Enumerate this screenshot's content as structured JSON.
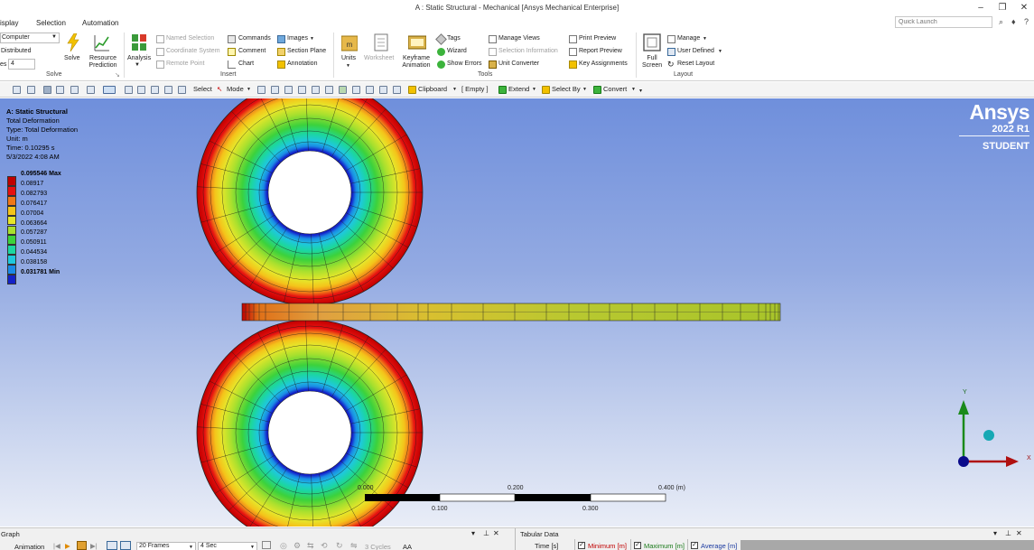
{
  "window": {
    "title": "A : Static Structural - Mechanical [Ansys Mechanical Enterprise]"
  },
  "menu": {
    "items": [
      "isplay",
      "Selection",
      "Automation"
    ],
    "quick_launch_placeholder": "Quick Launch"
  },
  "ribbon": {
    "solve": {
      "location_value": "Computer",
      "distributed_label": "Distributed",
      "cores_label": "es",
      "cores_value": "4",
      "solve_label": "Solve",
      "resource_prediction_label": "Resource Prediction",
      "group_label": "Solve"
    },
    "insert": {
      "analysis_label": "Analysis",
      "named_selection": "Named Selection",
      "coordinate_system": "Coordinate System",
      "remote_point": "Remote Point",
      "commands": "Commands",
      "comment": "Comment",
      "chart": "Chart",
      "images": "Images",
      "section_plane": "Section Plane",
      "annotation": "Annotation",
      "group_label": "Insert"
    },
    "tools": {
      "units": "Units",
      "worksheet": "Worksheet",
      "keyframe_animation": "Keyframe Animation",
      "tags": "Tags",
      "wizard": "Wizard",
      "show_errors": "Show Errors",
      "manage_views": "Manage Views",
      "selection_information": "Selection Information",
      "unit_converter": "Unit Converter",
      "print_preview": "Print Preview",
      "report_preview": "Report Preview",
      "key_assignments": "Key Assignments",
      "group_label": "Tools"
    },
    "layout": {
      "full_screen": "Full Screen",
      "manage": "Manage",
      "user_defined": "User Defined",
      "reset_layout": "Reset Layout",
      "group_label": "Layout"
    }
  },
  "toolbar": {
    "select": "Select",
    "mode": "Mode",
    "clipboard": "Clipboard",
    "empty": "[ Empty ]",
    "extend": "Extend",
    "select_by": "Select By",
    "convert": "Convert"
  },
  "viewport": {
    "info": {
      "title": "A: Static Structural",
      "result": "Total Deformation",
      "type": "Type: Total Deformation",
      "unit": "Unit: m",
      "time": "Time: 0.10295 s",
      "date": "5/3/2022 4:08 AM"
    },
    "legend": [
      {
        "label": "0.095546 Max",
        "color": "#c00000",
        "bold": true
      },
      {
        "label": "0.08917",
        "color": "#e61010",
        "bold": false
      },
      {
        "label": "0.082793",
        "color": "#f07818",
        "bold": false
      },
      {
        "label": "0.076417",
        "color": "#f4c41a",
        "bold": false
      },
      {
        "label": "0.07004",
        "color": "#e6e62a",
        "bold": false
      },
      {
        "label": "0.063664",
        "color": "#a8e02e",
        "bold": false
      },
      {
        "label": "0.057287",
        "color": "#3cd23c",
        "bold": false
      },
      {
        "label": "0.050911",
        "color": "#1cd6a0",
        "bold": false
      },
      {
        "label": "0.044534",
        "color": "#1ec8dc",
        "bold": false
      },
      {
        "label": "0.038158",
        "color": "#1a8ae6",
        "bold": false
      },
      {
        "label": "0.031781 Min",
        "color": "#1422c8",
        "bold": true
      }
    ],
    "brand": {
      "name": "Ansys",
      "version": "2022 R1",
      "edition": "STUDENT"
    },
    "scale": {
      "label_0": "0.000",
      "label_200": "0.200",
      "label_400": "0.400 (m)",
      "label_100": "0.100",
      "label_300": "0.300"
    },
    "triad": {
      "y": "Y",
      "x": "X"
    }
  },
  "bottom": {
    "graph_title": "Graph",
    "animation_label": "Animation",
    "frames": "20 Frames",
    "duration": "4 Sec",
    "cycles": "3 Cycles",
    "aa": "AA",
    "tabular_title": "Tabular Data",
    "col_time": "Time [s]",
    "col_min": "Minimum [m]",
    "col_max": "Maximum [m]",
    "col_avg": "Average [m]"
  }
}
